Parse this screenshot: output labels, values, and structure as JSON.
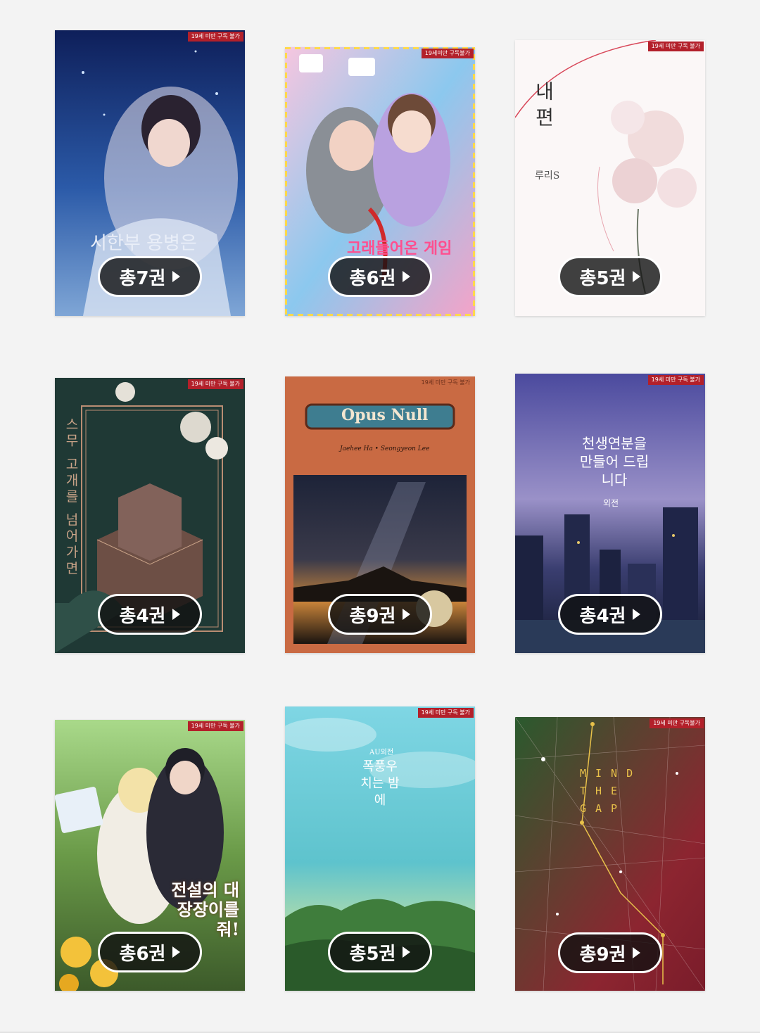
{
  "books": [
    {
      "age_badge": "19세 미만 구독 불가",
      "title": "시한부 용병은",
      "volume_label": "총7권",
      "palette": {
        "top": "#0e1f5a",
        "mid": "#2b5aa8",
        "bottom": "#7fa6d6",
        "accent": "#e8e0ea"
      }
    },
    {
      "age_badge": "19세미만 구독불가",
      "title": "고래들어온 게임",
      "volume_label": "총6권",
      "palette": {
        "top": "#f6c6df",
        "mid": "#8cc8ee",
        "bottom": "#f4a3c8",
        "accent": "#ffd94a"
      }
    },
    {
      "age_badge": "19세 미만 구독 불가",
      "title": "내 편",
      "author": "루리S",
      "volume_label": "총5권",
      "palette": {
        "top": "#ffffff",
        "mid": "#f7eeee",
        "bottom": "#f2e4e4",
        "accent": "#e8a6b0"
      }
    },
    {
      "age_badge": "19세 미만 구독 불가",
      "title": "스무 고개를 넘어가면",
      "volume_label": "총4권",
      "palette": {
        "top": "#1d3531",
        "mid": "#233f3a",
        "bottom": "#16282a",
        "accent": "#b98d73"
      }
    },
    {
      "age_badge": "19세 미만 구독 불가",
      "title": "Opus Null",
      "subtitle": "Jaehee Ha  •  Seongyeon Lee",
      "volume_label": "총9권",
      "palette": {
        "top": "#c96a43",
        "mid": "#c06642",
        "bottom": "#6e3b2a",
        "accent": "#3e7d90"
      }
    },
    {
      "age_badge": "19세 미만 구독 불가",
      "title": "천생연분을 만들어 드립니다",
      "author": "외전",
      "volume_label": "총4권",
      "palette": {
        "top": "#5c5aa6",
        "mid": "#8a83c0",
        "bottom": "#1c2240",
        "accent": "#e6c86a"
      }
    },
    {
      "age_badge": "19세 미만 구독 불가",
      "title": "전설의 대장장이를 줘!",
      "volume_label": "총6권",
      "palette": {
        "top": "#9ccf74",
        "mid": "#5a8a3a",
        "bottom": "#f3c23a",
        "accent": "#ffffff"
      }
    },
    {
      "age_badge": "19세 미만 구독 불가",
      "title": "폭풍우 치는 밤에",
      "subtitle": "AU외전",
      "volume_label": "총5권",
      "palette": {
        "top": "#9fe0ea",
        "mid": "#5fc6cf",
        "bottom": "#2f6b3a",
        "accent": "#ffffff"
      }
    },
    {
      "age_badge": "19세 미만 구독불가",
      "title": "MIND THE GAP",
      "volume_label": "총9권",
      "palette": {
        "top": "#2a5a2e",
        "mid": "#8c2530",
        "bottom": "#7a1c2a",
        "accent": "#e8c14a"
      }
    }
  ]
}
